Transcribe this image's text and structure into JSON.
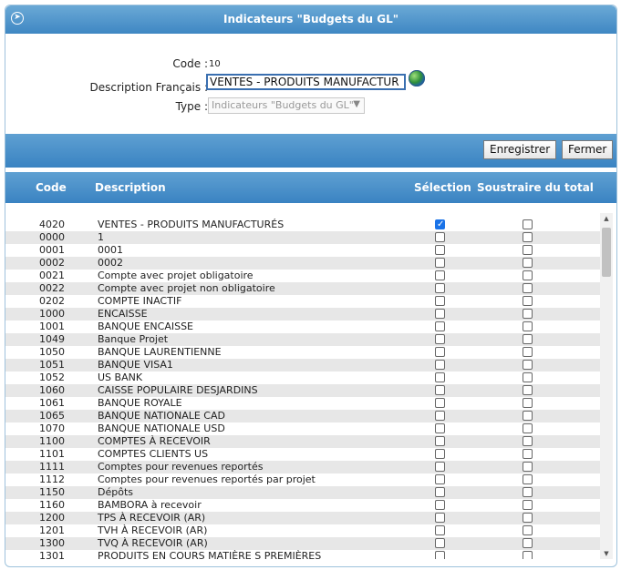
{
  "window": {
    "title": "Indicateurs \"Budgets du GL\""
  },
  "form": {
    "code_label": "Code :",
    "code_value": "10",
    "desc_label": "Description Français :",
    "desc_value": "VENTES - PRODUITS MANUFACTUR",
    "type_label": "Type :",
    "type_value": "Indicateurs \"Budgets du GL\""
  },
  "toolbar": {
    "save_label": "Enregistrer",
    "close_label": "Fermer"
  },
  "table": {
    "headers": {
      "code": "Code",
      "description": "Description",
      "selection": "Sélection",
      "subtract": "Soustraire du total"
    },
    "rows": [
      {
        "code": "4020",
        "desc": "VENTES - PRODUITS MANUFACTURÉS",
        "sel": true,
        "sub": false
      },
      {
        "code": "0000",
        "desc": "1",
        "sel": false,
        "sub": false
      },
      {
        "code": "0001",
        "desc": "0001",
        "sel": false,
        "sub": false
      },
      {
        "code": "0002",
        "desc": "0002",
        "sel": false,
        "sub": false
      },
      {
        "code": "0021",
        "desc": "Compte avec projet obligatoire",
        "sel": false,
        "sub": false
      },
      {
        "code": "0022",
        "desc": "Compte avec projet non obligatoire",
        "sel": false,
        "sub": false
      },
      {
        "code": "0202",
        "desc": "COMPTE INACTIF",
        "sel": false,
        "sub": false
      },
      {
        "code": "1000",
        "desc": "ENCAISSE",
        "sel": false,
        "sub": false
      },
      {
        "code": "1001",
        "desc": "BANQUE ENCAISSE",
        "sel": false,
        "sub": false
      },
      {
        "code": "1049",
        "desc": "Banque Projet",
        "sel": false,
        "sub": false
      },
      {
        "code": "1050",
        "desc": "BANQUE LAURENTIENNE",
        "sel": false,
        "sub": false
      },
      {
        "code": "1051",
        "desc": "BANQUE VISA1",
        "sel": false,
        "sub": false
      },
      {
        "code": "1052",
        "desc": "US BANK",
        "sel": false,
        "sub": false
      },
      {
        "code": "1060",
        "desc": "CAISSE POPULAIRE DESJARDINS",
        "sel": false,
        "sub": false
      },
      {
        "code": "1061",
        "desc": "BANQUE ROYALE",
        "sel": false,
        "sub": false
      },
      {
        "code": "1065",
        "desc": "BANQUE NATIONALE CAD",
        "sel": false,
        "sub": false
      },
      {
        "code": "1070",
        "desc": "BANQUE NATIONALE USD",
        "sel": false,
        "sub": false
      },
      {
        "code": "1100",
        "desc": "COMPTES À RECEVOIR",
        "sel": false,
        "sub": false
      },
      {
        "code": "1101",
        "desc": "COMPTES CLIENTS US",
        "sel": false,
        "sub": false
      },
      {
        "code": "1111",
        "desc": "Comptes pour revenues reportés",
        "sel": false,
        "sub": false
      },
      {
        "code": "1112",
        "desc": "Comptes pour revenues reportés par projet",
        "sel": false,
        "sub": false
      },
      {
        "code": "1150",
        "desc": "Dépôts",
        "sel": false,
        "sub": false
      },
      {
        "code": "1160",
        "desc": "BAMBORA à recevoir",
        "sel": false,
        "sub": false
      },
      {
        "code": "1200",
        "desc": "TPS À RECEVOIR (AR)",
        "sel": false,
        "sub": false
      },
      {
        "code": "1201",
        "desc": "TVH À RECEVOIR (AR)",
        "sel": false,
        "sub": false
      },
      {
        "code": "1300",
        "desc": "TVQ À RECEVOIR (AR)",
        "sel": false,
        "sub": false
      },
      {
        "code": "1301",
        "desc": "PRODUITS EN COURS MATIÈRE S PREMIÈRES",
        "sel": false,
        "sub": false
      }
    ]
  },
  "icons": {
    "nav": "circle-arrow-right-icon",
    "globe": "globe-icon"
  }
}
